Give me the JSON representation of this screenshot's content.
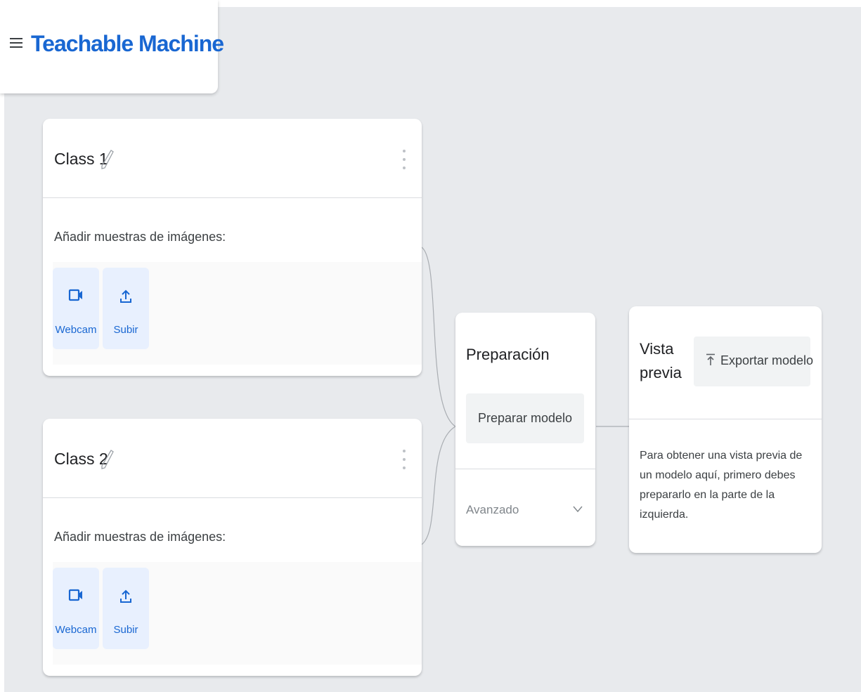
{
  "header": {
    "brand": "Teachable Machine"
  },
  "classes": [
    {
      "name": "Class 1",
      "samples_label": "Añadir muestras de imágenes:",
      "webcam_label": "Webcam",
      "upload_label": "Subir"
    },
    {
      "name": "Class 2",
      "samples_label": "Añadir muestras de imágenes:",
      "webcam_label": "Webcam",
      "upload_label": "Subir"
    }
  ],
  "training": {
    "title": "Preparación",
    "train_button": "Preparar modelo",
    "advanced_label": "Avanzado"
  },
  "preview": {
    "title_line1": "Vista",
    "title_line2": "previa",
    "export_button": "Exportar modelo",
    "message": "Para obtener una vista previa de un modelo aquí, primero debes prepararlo en la parte de la izquierda."
  },
  "colors": {
    "brand": "#1967d2",
    "background": "#e8eaed",
    "sample_button_bg": "#e8f0fe",
    "accent_text": "#1967d2"
  },
  "icons": {
    "menu": "hamburger-menu-icon",
    "edit": "pencil-icon",
    "more": "more-vert-icon",
    "webcam": "videocam-icon",
    "upload": "upload-icon",
    "expand": "chevron-down-icon",
    "export": "export-icon"
  }
}
